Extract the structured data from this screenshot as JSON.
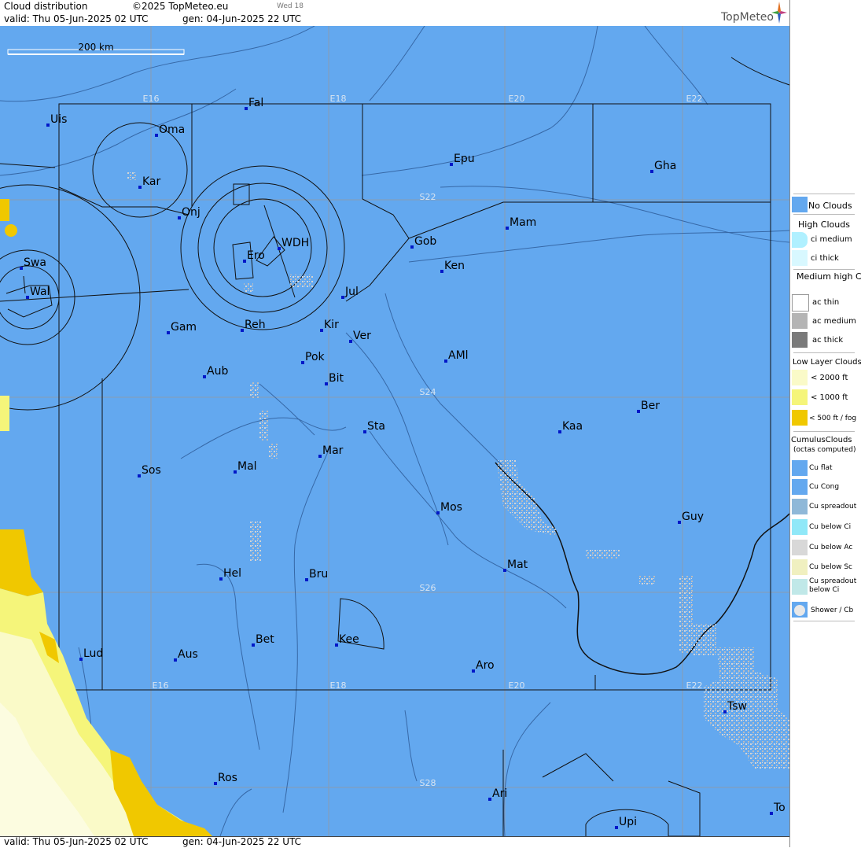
{
  "header": {
    "title": "Cloud distribution",
    "copyright": "©2025 TopMeteo.eu",
    "day_label": "Wed 18",
    "valid": "valid:  Thu  05-Jun-2025  02 UTC",
    "generated": "gen: 04-Jun-2025 22 UTC",
    "logo": "TopMeteo"
  },
  "footer": {
    "valid": "valid:  Thu  05-Jun-2025  02 UTC",
    "generated": "gen: 04-Jun-2025 22 UTC"
  },
  "scale_bar": "200 km",
  "grid_labels": {
    "top": [
      "E16",
      "E18",
      "E20",
      "E22"
    ],
    "bottom": [
      "E16",
      "E18",
      "E20",
      "E22"
    ],
    "lat": [
      "S22",
      "S24",
      "S26",
      "S28"
    ]
  },
  "places": [
    "Uis",
    "Fal",
    "Oma",
    "Kar",
    "Epu",
    "Gha",
    "Onj",
    "Mam",
    "Gob",
    "WDH",
    "Ero",
    "Ken",
    "Swa",
    "Wal",
    "Jul",
    "Gam",
    "Reh",
    "Kir",
    "Ver",
    "Pok",
    "AMl",
    "Bit",
    "Aub",
    "Ber",
    "Sta",
    "Kaa",
    "Mar",
    "Sos",
    "Mal",
    "Mos",
    "Guy",
    "Mat",
    "Hel",
    "Bru",
    "Lud",
    "Aus",
    "Bet",
    "Kee",
    "Aro",
    "Tsw",
    "Ros",
    "Ari",
    "To",
    "Upi"
  ],
  "legend": {
    "no_clouds": "No Clouds",
    "high_clouds": "High Clouds",
    "ci_medium": "ci medium",
    "ci_thick": "ci thick",
    "medium_high_clouds": "Medium high Clouds",
    "ac_thin": "ac thin",
    "ac_medium": "ac medium",
    "ac_thick": "ac thick",
    "low_layer_clouds": "Low Layer Clouds",
    "low_2000": "< 2000 ft",
    "low_1000": "< 1000 ft",
    "low_500": "< 500 ft / fog",
    "cumulus_clouds": "CumulusClouds",
    "octas": "(octas computed)",
    "cu_flat": "Cu flat",
    "cu_cong": "Cu Cong",
    "cu_spreadout": "Cu spreadout",
    "cu_below_ci": "Cu below Ci",
    "cu_below_ac": "Cu below Ac",
    "cu_below_sc": "Cu below Sc",
    "cu_spreadout_below_ci": "Cu spreadout below Ci",
    "shower_cb": "Shower / Cb"
  },
  "colors": {
    "no_clouds": "#63a8ef",
    "low_2000": "#fafac8",
    "low_1000": "#f5f57a",
    "low_500": "#f0c800",
    "cu_dots": "#c8c8c8"
  }
}
